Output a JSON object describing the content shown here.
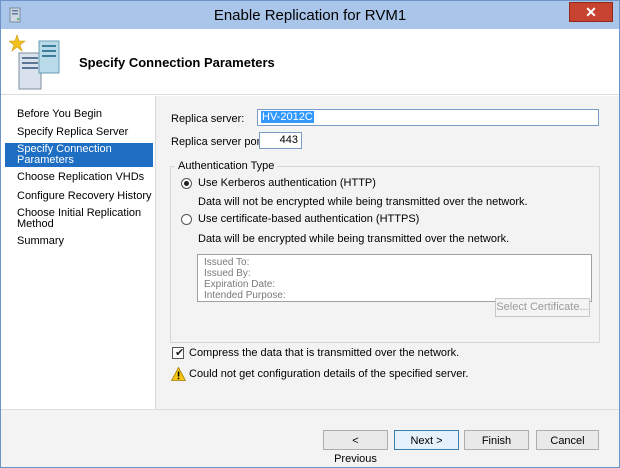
{
  "window": {
    "title": "Enable Replication for RVM1",
    "close_glyph": "✕",
    "icon": "server-app-icon"
  },
  "header": {
    "title": "Specify Connection Parameters",
    "icon": "server-wizard-icon"
  },
  "nav": {
    "items": [
      {
        "label": "Before You Begin",
        "active": false
      },
      {
        "label": "Specify Replica Server",
        "active": false
      },
      {
        "label": "Specify Connection Parameters",
        "active": true
      },
      {
        "label": "Choose Replication VHDs",
        "active": false
      },
      {
        "label": "Configure Recovery History",
        "active": false
      },
      {
        "label": "Choose Initial Replication Method",
        "active": false
      },
      {
        "label": "Summary",
        "active": false
      }
    ]
  },
  "form": {
    "replica_server_label": "Replica server:",
    "replica_server_value": "HV-2012C",
    "replica_port_label": "Replica server port:",
    "replica_port_value": "443",
    "auth_group_title": "Authentication Type",
    "kerberos_label": "Use Kerberos authentication (HTTP)",
    "kerberos_checked": true,
    "kerberos_note": "Data will not be encrypted while being transmitted over the network.",
    "cert_label": "Use certificate-based authentication (HTTPS)",
    "cert_checked": false,
    "cert_note": "Data will be encrypted while being transmitted over the network.",
    "cert_fields": [
      "Issued To:",
      "Issued By:",
      "Expiration Date:",
      "Intended Purpose:"
    ],
    "select_cert_label": "Select Certificate...",
    "compress_label": "Compress the data that is transmitted over the network.",
    "compress_checked": true,
    "check_glyph": "✔",
    "warning_text": "Could not get configuration details of the specified server.",
    "warning_icon": "warning-icon"
  },
  "footer": {
    "previous_label": "< Previous",
    "next_label": "Next >",
    "finish_label": "Finish",
    "cancel_label": "Cancel"
  },
  "colors": {
    "titlebar": "#a9c6ea",
    "close_button": "#c7432f",
    "nav_active": "#1e6fc3",
    "selection": "#3399ff"
  }
}
